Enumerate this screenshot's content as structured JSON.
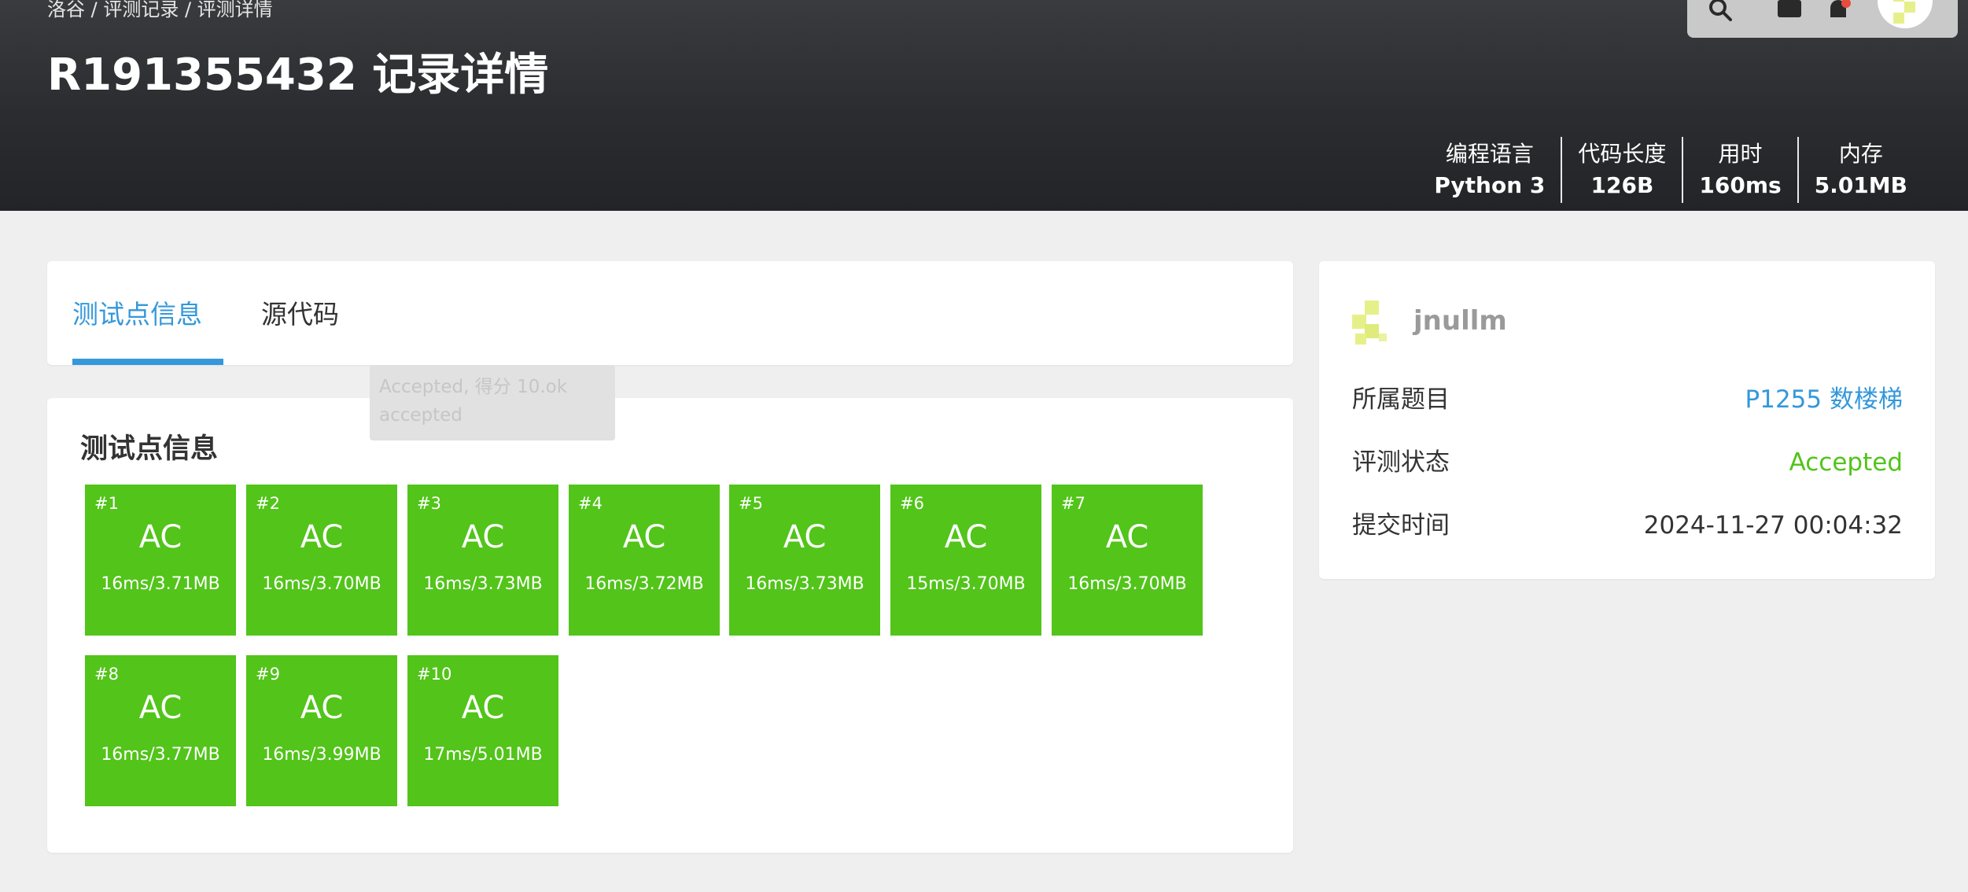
{
  "header": {
    "breadcrumb": "洛谷 / 评测记录 / 评测详情",
    "title": "R191355432 记录详情",
    "stats": [
      {
        "label": "编程语言",
        "value": "Python 3"
      },
      {
        "label": "代码长度",
        "value": "126B"
      },
      {
        "label": "用时",
        "value": "160ms"
      },
      {
        "label": "内存",
        "value": "5.01MB"
      }
    ]
  },
  "tabs": [
    {
      "label": "测试点信息",
      "active": true
    },
    {
      "label": "源代码",
      "active": false
    }
  ],
  "tooltip": {
    "line1": "Accepted, 得分 10.ok",
    "line2": "accepted"
  },
  "tests": {
    "title": "测试点信息",
    "cases": [
      {
        "num": "#1",
        "status": "AC",
        "info": "16ms/3.71MB"
      },
      {
        "num": "#2",
        "status": "AC",
        "info": "16ms/3.70MB"
      },
      {
        "num": "#3",
        "status": "AC",
        "info": "16ms/3.73MB"
      },
      {
        "num": "#4",
        "status": "AC",
        "info": "16ms/3.72MB"
      },
      {
        "num": "#5",
        "status": "AC",
        "info": "16ms/3.73MB"
      },
      {
        "num": "#6",
        "status": "AC",
        "info": "15ms/3.70MB"
      },
      {
        "num": "#7",
        "status": "AC",
        "info": "16ms/3.70MB"
      },
      {
        "num": "#8",
        "status": "AC",
        "info": "16ms/3.77MB"
      },
      {
        "num": "#9",
        "status": "AC",
        "info": "16ms/3.99MB"
      },
      {
        "num": "#10",
        "status": "AC",
        "info": "17ms/5.01MB"
      }
    ]
  },
  "info": {
    "username": "jnullm",
    "problem_label": "所属题目",
    "problem_value": "P1255 数楼梯",
    "status_label": "评测状态",
    "status_value": "Accepted",
    "time_label": "提交时间",
    "time_value": "2024-11-27 00:04:32"
  },
  "icons": {
    "search": "search-icon",
    "message": "message-icon",
    "bell": "bell-icon",
    "avatar": "avatar"
  },
  "colors": {
    "accent": "#3498db",
    "accepted": "#52c41a",
    "header": "#2b2c30"
  }
}
